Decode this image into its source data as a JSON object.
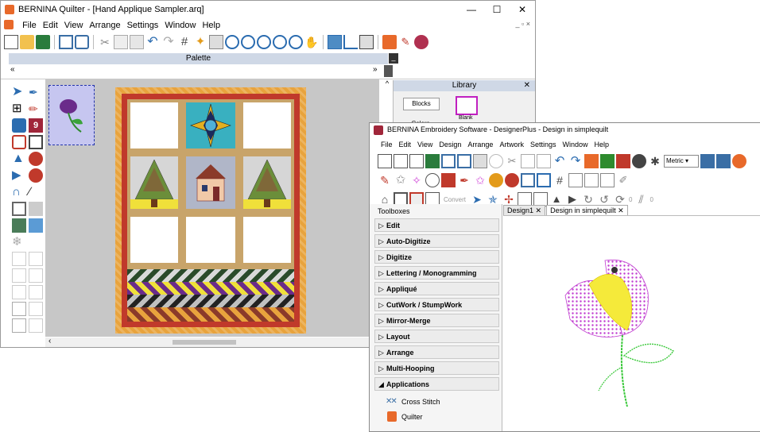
{
  "quilter": {
    "title": "BERNINA Quilter - [Hand Applique Sampler.arq]",
    "menu": [
      "File",
      "Edit",
      "View",
      "Arrange",
      "Settings",
      "Window",
      "Help"
    ],
    "window_controls": {
      "minimize": "—",
      "maximize": "☐",
      "close": "✕"
    },
    "child_controls": "_ ▫ ×",
    "palette_title": "Palette",
    "palette_scroll_left": "«",
    "palette_scroll_right": "»",
    "library": {
      "title": "Library",
      "close": "✕",
      "tabs": [
        "Blocks",
        "Colors"
      ],
      "items": [
        {
          "label": "Blank"
        }
      ]
    },
    "hscroll_left": "‹"
  },
  "embroidery": {
    "title": "BERNINA Embroidery Software - DesignerPlus - Design in simplequilt",
    "menu": [
      "File",
      "Edit",
      "View",
      "Design",
      "Arrange",
      "Artwork",
      "Settings",
      "Window",
      "Help"
    ],
    "units_dropdown": "Metric",
    "convert_label": "Convert",
    "spin_value_1": "0",
    "spin_value_2": "0",
    "toolboxes_title": "Toolboxes",
    "toolboxes": [
      {
        "label": "Edit",
        "arrow": "▷"
      },
      {
        "label": "Auto-Digitize",
        "arrow": "▷"
      },
      {
        "label": "Digitize",
        "arrow": "▷"
      },
      {
        "label": "Lettering / Monogramming",
        "arrow": "▷"
      },
      {
        "label": "Appliqué",
        "arrow": "▷"
      },
      {
        "label": "CutWork / StumpWork",
        "arrow": "▷"
      },
      {
        "label": "Mirror-Merge",
        "arrow": "▷"
      },
      {
        "label": "Layout",
        "arrow": "▷"
      },
      {
        "label": "Arrange",
        "arrow": "▷"
      },
      {
        "label": "Multi-Hooping",
        "arrow": "▷"
      },
      {
        "label": "Applications",
        "arrow": "◢"
      }
    ],
    "applications": [
      {
        "label": "Cross Stitch"
      },
      {
        "label": "Quilter"
      }
    ],
    "tabs": [
      {
        "label": "Design1",
        "close": "✕"
      },
      {
        "label": "Design in simplequilt",
        "close": "✕"
      }
    ]
  },
  "colors": {
    "quilt_border": "#c0392b",
    "quilt_outer": "#e8a33d",
    "sashing": "#c8a46a",
    "canvas_bg": "#c7c7c7",
    "tulip_pink": "#d04ad8",
    "tulip_yellow": "#f5ea3a",
    "stem_green": "#3cc93c"
  }
}
